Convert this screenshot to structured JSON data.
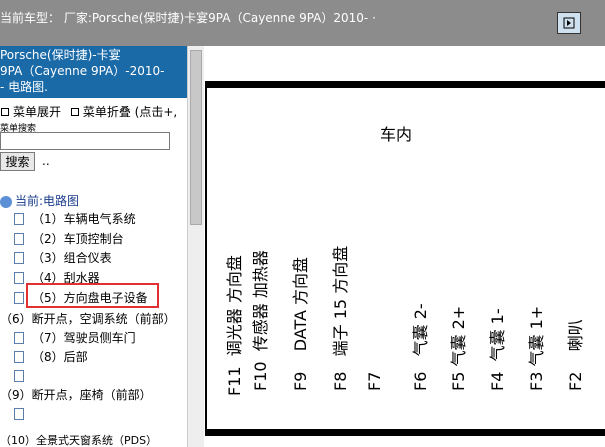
{
  "top_bar": {
    "title": "当前车型：  厂家:Porsche(保时捷)卡宴9PA（Cayenne 9PA）2010-  ·"
  },
  "sidebar": {
    "header_lines": [
      "Porsche(保时捷)-卡宴",
      "9PA（Cayenne 9PA）-2010-",
      "- 电路图."
    ],
    "menu_expand": "菜单展开",
    "menu_collapse": "菜单折叠 (点击+,",
    "search_label": "菜单搜索",
    "search_button": "搜索",
    "dots": "..",
    "tree_root": "当前:电路图",
    "tree_items": [
      "（1）车辆电气系统",
      "（2）车顶控制台",
      "（3）组合仪表",
      "（4）刮水器",
      "（5）方向盘电子设备",
      "（6）断开点，空调系统（前部）",
      "（7）驾驶员侧车门",
      "（8）后部",
      "（9）断开点，座椅（前部）",
      "（10）全景式天窗系统（PDS）"
    ]
  },
  "diagram": {
    "area_label": "车内",
    "pin_labels": [
      {
        "pin": "F11",
        "desc": "调光器  方向盘"
      },
      {
        "pin": "F10",
        "desc": "传感器  加热器"
      },
      {
        "pin": "F9",
        "desc": "DATA  方向盘"
      },
      {
        "pin": "F8",
        "desc": "端子 15  方向盘"
      },
      {
        "pin": "F7",
        "desc": ""
      },
      {
        "pin": "F6",
        "desc": "气囊 2-"
      },
      {
        "pin": "F5",
        "desc": "气囊 2+"
      },
      {
        "pin": "F4",
        "desc": "气囊 1-"
      },
      {
        "pin": "F3",
        "desc": "气囊 1+"
      },
      {
        "pin": "F2",
        "desc": "喇叭"
      }
    ]
  },
  "colors": {
    "top_bar": "#8c8c8c",
    "header_bg": "#1a6aa8",
    "highlight": "#e03030"
  }
}
